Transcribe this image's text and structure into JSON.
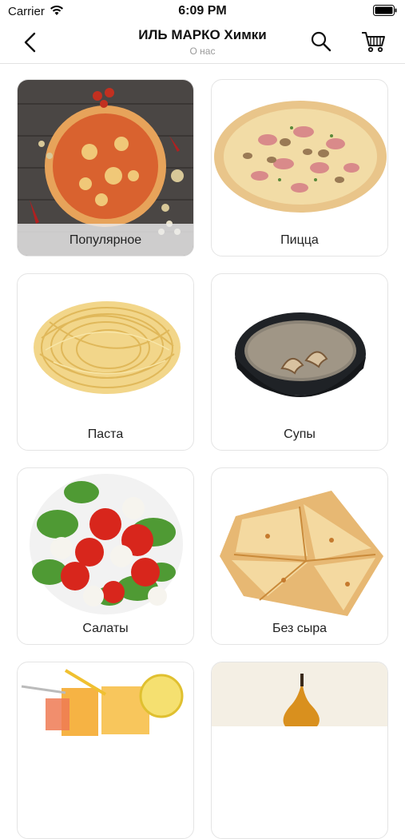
{
  "status_bar": {
    "carrier": "Carrier",
    "time": "6:09 PM"
  },
  "nav": {
    "title": "ИЛЬ МАРКО Химки",
    "subtitle": "О нас"
  },
  "categories": [
    {
      "label": "Популярное",
      "image": "pizza-on-wood"
    },
    {
      "label": "Пицца",
      "image": "ham-mushroom-pizza"
    },
    {
      "label": "Паста",
      "image": "spaghetti-nest"
    },
    {
      "label": "Супы",
      "image": "mushroom-soup-bowl"
    },
    {
      "label": "Салаты",
      "image": "caprese-salad"
    },
    {
      "label": "Без сыра",
      "image": "flatbread-slices"
    },
    {
      "label": "",
      "image": "juice-glasses"
    },
    {
      "label": "",
      "image": "pear-dessert"
    }
  ],
  "colors": {
    "divider": "#e2e2e2",
    "subtitle": "#9a9a9a",
    "card_border": "#e4e4e4"
  }
}
